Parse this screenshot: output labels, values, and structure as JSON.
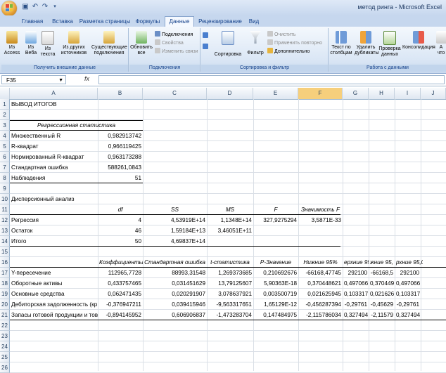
{
  "window": {
    "title": "метод ринга - Microsoft Excel"
  },
  "tabs": [
    "Главная",
    "Вставка",
    "Разметка страницы",
    "Формулы",
    "Данные",
    "Рецензирование",
    "Вид"
  ],
  "active_tab": "Данные",
  "ribbon": {
    "groups": {
      "external": "Получить внешние данные",
      "connections": "Подключения",
      "sort_filter": "Сортировка и фильтр",
      "data_tools": "Работа с данными"
    },
    "buttons": {
      "from_access": [
        "Из",
        "Access"
      ],
      "from_web": [
        "Из",
        "Веба"
      ],
      "from_text": [
        "Из",
        "текста"
      ],
      "from_other": [
        "Из других",
        "источников"
      ],
      "existing": [
        "Существующие",
        "подключения"
      ],
      "refresh": [
        "Обновить",
        "все"
      ],
      "connections": "Подключения",
      "properties": "Свойства",
      "edit_links": "Изменить связи",
      "sort": "Сортировка",
      "filter": "Фильтр",
      "clear": "Очистить",
      "reapply": "Применить повторно",
      "advanced": "Дополнительно",
      "text_to_columns": [
        "Текст по",
        "столбцам"
      ],
      "remove_dup": [
        "Удалить",
        "дубликаты"
      ],
      "validation": [
        "Проверка",
        "данных"
      ],
      "consolidate": "Консолидация",
      "whatif": [
        "А",
        "что"
      ]
    }
  },
  "formula_bar": {
    "name_box": "F35",
    "fx": "fx",
    "value": ""
  },
  "columns": [
    "A",
    "B",
    "C",
    "D",
    "E",
    "F",
    "G",
    "H",
    "I",
    "J"
  ],
  "selected_column": "F",
  "rows": [
    "1",
    "2",
    "3",
    "4",
    "5",
    "6",
    "7",
    "8",
    "9",
    "10",
    "11",
    "12",
    "13",
    "14",
    "15",
    "16",
    "17",
    "18",
    "19",
    "20",
    "21",
    "22",
    "23",
    "24",
    "25",
    "26"
  ],
  "sheet": {
    "r1": {
      "A": "ВЫВОД ИТОГОВ"
    },
    "r3": {
      "A": "Регрессионная статистика"
    },
    "r4": {
      "A": "Множественный R",
      "B": "0,982913742"
    },
    "r5": {
      "A": "R-квадрат",
      "B": "0,966119425"
    },
    "r6": {
      "A": "Нормированный R-квадрат",
      "B": "0,963173288"
    },
    "r7": {
      "A": "Стандартная ошибка",
      "B": "588261,0843"
    },
    "r8": {
      "A": "Наблюдения",
      "B": "51"
    },
    "r10": {
      "A": "Дисперсионный анализ"
    },
    "r11": {
      "B": "df",
      "C": "SS",
      "D": "MS",
      "E": "F",
      "F": "Значимость F"
    },
    "r12": {
      "A": "Регрессия",
      "B": "4",
      "C": "4,53919E+14",
      "D": "1,1348E+14",
      "E": "327,9275294",
      "F": "3,5871E-33"
    },
    "r13": {
      "A": "Остаток",
      "B": "46",
      "C": "1,59184E+13",
      "D": "3,46051E+11"
    },
    "r14": {
      "A": "Итого",
      "B": "50",
      "C": "4,69837E+14"
    },
    "r16": {
      "B": "Коэффициенты",
      "C": "Стандартная ошибка",
      "D": "t-статистика",
      "E": "P-Значение",
      "F": "Нижние 95%",
      "G": "ерхние 95",
      "H": "жние 95,",
      "I": "рхние 95,0%"
    },
    "r17": {
      "A": "Y-пересечение",
      "B": "112965,7728",
      "C": "88993,31548",
      "D": "1,269373685",
      "E": "0,210692676",
      "F": "-66168,47745",
      "G": "292100",
      "H": "-66168,5",
      "I": "292100"
    },
    "r18": {
      "A": "Оборотные активы",
      "B": "0,433757465",
      "C": "0,031451629",
      "D": "13,79125607",
      "E": "5,90363E-18",
      "F": "0,370448621",
      "G": "0,497066",
      "H": "0,370449",
      "I": "0,497066"
    },
    "r19": {
      "A": "Основные средства",
      "B": "0,062471435",
      "C": "0,020291907",
      "D": "3,078637921",
      "E": "0,003500719",
      "F": "0,021625945",
      "G": "0,103317",
      "H": "0,021626",
      "I": "0,103317"
    },
    "r20": {
      "A": "Дебиторская задолженность (кр",
      "B": "-0,376947211",
      "C": "0,039415946",
      "D": "-9,563317651",
      "E": "1,65129E-12",
      "F": "-0,456287394",
      "G": "-0,29761",
      "H": "-0,45629",
      "I": "-0,29761"
    },
    "r21": {
      "A": "Запасы готовой продукции и тов",
      "B": "-0,894145952",
      "C": "0,606906837",
      "D": "-1,473283704",
      "E": "0,147484975",
      "F": "-2,115786034",
      "G": "0,327494",
      "H": "-2,11579",
      "I": "0,327494"
    }
  }
}
